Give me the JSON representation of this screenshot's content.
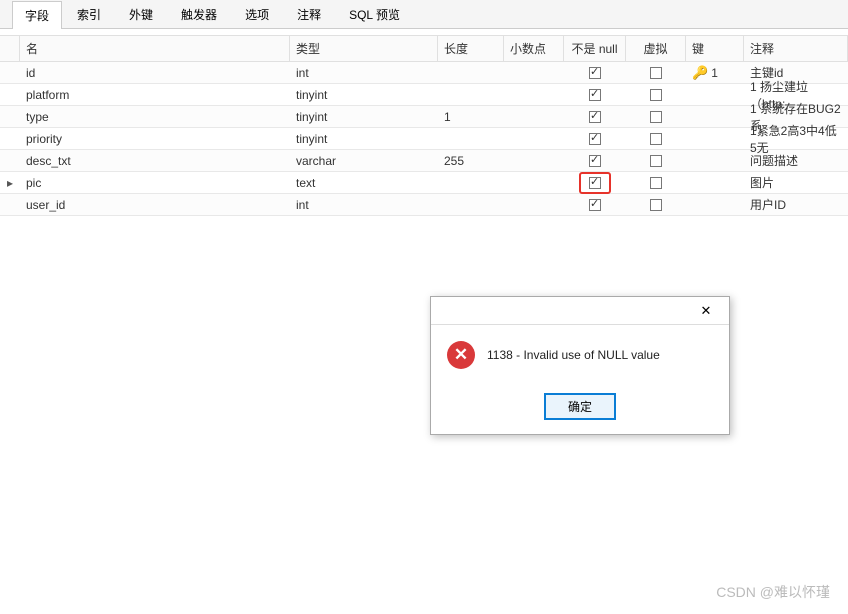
{
  "tabs": [
    {
      "label": "字段",
      "active": true
    },
    {
      "label": "索引",
      "active": false
    },
    {
      "label": "外键",
      "active": false
    },
    {
      "label": "触发器",
      "active": false
    },
    {
      "label": "选项",
      "active": false
    },
    {
      "label": "注释",
      "active": false
    },
    {
      "label": "SQL 预览",
      "active": false
    }
  ],
  "columns": {
    "name": "名",
    "type": "类型",
    "length": "长度",
    "decimals": "小数点",
    "not_null": "不是 null",
    "virtual": "虚拟",
    "key": "键",
    "comment": "注释"
  },
  "rows": [
    {
      "name": "id",
      "type": "int",
      "len": "",
      "dec": "",
      "not_null": true,
      "virtual": false,
      "key": "1",
      "comment": "主键id",
      "active": false,
      "highlight": false
    },
    {
      "name": "platform",
      "type": "tinyint",
      "len": "",
      "dec": "",
      "not_null": true,
      "virtual": false,
      "key": "",
      "comment": "1 扬尘建垃（http:,",
      "active": false,
      "highlight": false
    },
    {
      "name": "type",
      "type": "tinyint",
      "len": "1",
      "dec": "",
      "not_null": true,
      "virtual": false,
      "key": "",
      "comment": "1 系统存在BUG2 系",
      "active": false,
      "highlight": false
    },
    {
      "name": "priority",
      "type": "tinyint",
      "len": "",
      "dec": "",
      "not_null": true,
      "virtual": false,
      "key": "",
      "comment": "1紧急2高3中4低5无",
      "active": false,
      "highlight": false
    },
    {
      "name": "desc_txt",
      "type": "varchar",
      "len": "255",
      "dec": "",
      "not_null": true,
      "virtual": false,
      "key": "",
      "comment": "问题描述",
      "active": false,
      "highlight": false
    },
    {
      "name": "pic",
      "type": "text",
      "len": "",
      "dec": "",
      "not_null": true,
      "virtual": false,
      "key": "",
      "comment": "图片",
      "active": true,
      "highlight": true
    },
    {
      "name": "user_id",
      "type": "int",
      "len": "",
      "dec": "",
      "not_null": true,
      "virtual": false,
      "key": "",
      "comment": "用户ID",
      "active": false,
      "highlight": false
    }
  ],
  "dialog": {
    "message": "1138 - Invalid use of NULL value",
    "ok": "确定"
  },
  "watermark": "CSDN @难以怀瑾"
}
